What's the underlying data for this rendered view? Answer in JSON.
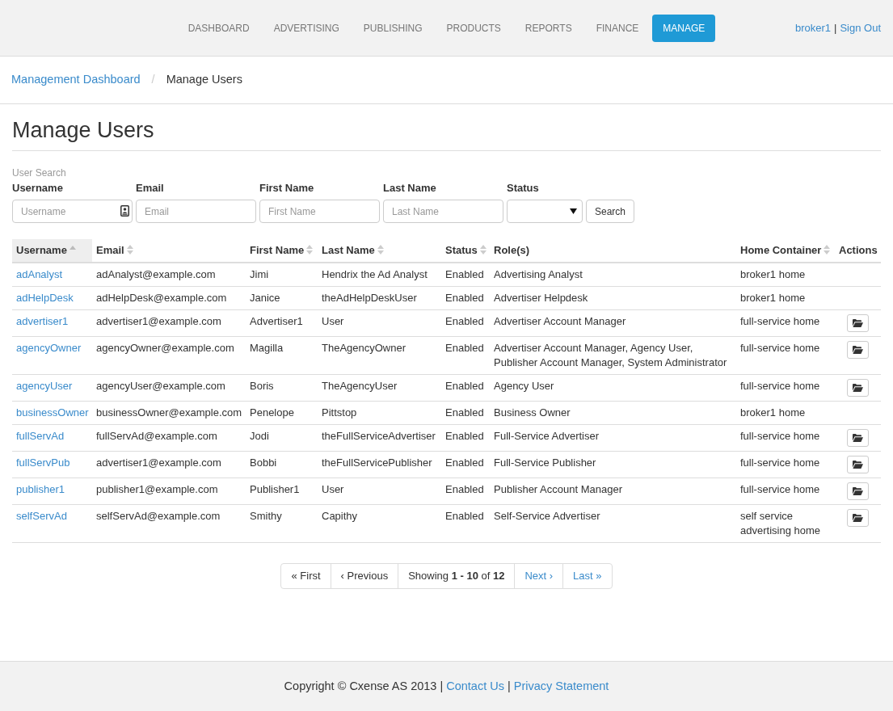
{
  "nav": {
    "items": [
      {
        "label": "DASHBOARD",
        "selected": false
      },
      {
        "label": "ADVERTISING",
        "selected": false
      },
      {
        "label": "PUBLISHING",
        "selected": false
      },
      {
        "label": "PRODUCTS",
        "selected": false
      },
      {
        "label": "REPORTS",
        "selected": false
      },
      {
        "label": "FINANCE",
        "selected": false
      },
      {
        "label": "MANAGE",
        "selected": true
      }
    ],
    "user": [
      {
        "kind": "account",
        "text": "broker1"
      },
      {
        "kind": "divider",
        "text": "|"
      },
      {
        "kind": "signout",
        "text": "Sign Out"
      }
    ]
  },
  "breadcrumb": [
    {
      "kind": "link",
      "text": "Management Dashboard"
    },
    {
      "kind": "divider",
      "text": "/"
    },
    {
      "kind": "current",
      "text": "Manage Users"
    }
  ],
  "title": "Manage Users",
  "search": {
    "legend": "User Search",
    "fields": [
      {
        "kind": "text-icon",
        "label": "Username",
        "placeholder": "Username"
      },
      {
        "kind": "text",
        "label": "Email",
        "placeholder": "Email"
      },
      {
        "kind": "text",
        "label": "First Name",
        "placeholder": "First Name"
      },
      {
        "kind": "text",
        "label": "Last Name",
        "placeholder": "Last Name"
      },
      {
        "kind": "select",
        "label": "Status"
      }
    ],
    "button": "Search"
  },
  "table": {
    "columns": [
      {
        "label": "Username",
        "sortable": true,
        "sorted": true
      },
      {
        "label": "Email",
        "sortable": true,
        "sorted": false
      },
      {
        "label": "First Name",
        "sortable": true,
        "sorted": false
      },
      {
        "label": "Last Name",
        "sortable": true,
        "sorted": false
      },
      {
        "label": "Status",
        "sortable": true,
        "sorted": false
      },
      {
        "label": "Role(s)",
        "sortable": false,
        "sorted": false
      },
      {
        "label": "Home Container",
        "sortable": true,
        "sorted": false
      },
      {
        "label": "Actions",
        "sortable": false,
        "sorted": false
      }
    ],
    "rows": [
      {
        "username": "adAnalyst",
        "email": "adAnalyst@example.com",
        "first_name": "Jimi",
        "last_name": "Hendrix the Ad Analyst",
        "status": "Enabled",
        "roles": "Advertising Analyst",
        "home_container": "broker1 home",
        "open_button": false
      },
      {
        "username": "adHelpDesk",
        "email": "adHelpDesk@example.com",
        "first_name": "Janice",
        "last_name": "theAdHelpDeskUser",
        "status": "Enabled",
        "roles": "Advertiser Helpdesk",
        "home_container": "broker1 home",
        "open_button": false
      },
      {
        "username": "advertiser1",
        "email": "advertiser1@example.com",
        "first_name": "Advertiser1",
        "last_name": "User",
        "status": "Enabled",
        "roles": "Advertiser Account Manager",
        "home_container": "full-service home",
        "open_button": true
      },
      {
        "username": "agencyOwner",
        "email": "agencyOwner@example.com",
        "first_name": "Magilla",
        "last_name": "TheAgencyOwner",
        "status": "Enabled",
        "roles": "Advertiser Account Manager, Agency User, Publisher Account Manager, System Administrator",
        "home_container": "full-service home",
        "open_button": true
      },
      {
        "username": "agencyUser",
        "email": "agencyUser@example.com",
        "first_name": "Boris",
        "last_name": "TheAgencyUser",
        "status": "Enabled",
        "roles": "Agency User",
        "home_container": "full-service home",
        "open_button": true
      },
      {
        "username": "businessOwner",
        "email": "businessOwner@example.com",
        "first_name": "Penelope",
        "last_name": "Pittstop",
        "status": "Enabled",
        "roles": "Business Owner",
        "home_container": "broker1 home",
        "open_button": false
      },
      {
        "username": "fullServAd",
        "email": "fullServAd@example.com",
        "first_name": "Jodi",
        "last_name": "theFullServiceAdvertiser",
        "status": "Enabled",
        "roles": "Full-Service Advertiser",
        "home_container": "full-service home",
        "open_button": true
      },
      {
        "username": "fullServPub",
        "email": "advertiser1@example.com",
        "first_name": "Bobbi",
        "last_name": "theFullServicePublisher",
        "status": "Enabled",
        "roles": "Full-Service Publisher",
        "home_container": "full-service home",
        "open_button": true
      },
      {
        "username": "publisher1",
        "email": "publisher1@example.com",
        "first_name": "Publisher1",
        "last_name": "User",
        "status": "Enabled",
        "roles": "Publisher Account Manager",
        "home_container": "full-service home",
        "open_button": true
      },
      {
        "username": "selfServAd",
        "email": "selfServAd@example.com",
        "first_name": "Smithy",
        "last_name": "Capithy",
        "status": "Enabled",
        "roles": "Self-Service Advertiser",
        "home_container": "self service advertising home",
        "open_button": true
      }
    ]
  },
  "pagination": [
    {
      "kind": "page",
      "text": "« First",
      "disabled": true
    },
    {
      "kind": "page",
      "text": "‹ Previous",
      "disabled": true
    },
    {
      "kind": "info",
      "text": "Showing **1 - 10** of **12**"
    },
    {
      "kind": "page",
      "text": "Next ›",
      "disabled": false
    },
    {
      "kind": "page",
      "text": "Last »",
      "disabled": false
    }
  ],
  "footer": [
    {
      "kind": "text",
      "text": "Copyright © Cxense AS 2013"
    },
    {
      "kind": "divider",
      "text": "|"
    },
    {
      "kind": "link",
      "text": "Contact Us"
    },
    {
      "kind": "divider",
      "text": "|"
    },
    {
      "kind": "link",
      "text": "Privacy Statement"
    }
  ]
}
